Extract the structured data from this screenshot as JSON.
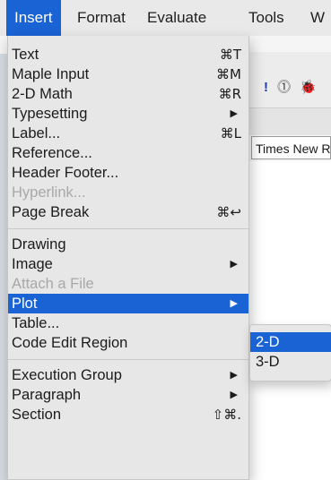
{
  "menubar": {
    "items": [
      "Insert",
      "Format",
      "Evaluate",
      "Tools",
      "W"
    ]
  },
  "background": {
    "font_box_value": "Times New Roman",
    "toolbar_icons": [
      "!",
      "⓵",
      "🐞"
    ]
  },
  "insert_menu": {
    "items": [
      {
        "label": "Text",
        "shortcut": "⌘T"
      },
      {
        "label": "Maple Input",
        "shortcut": "⌘M"
      },
      {
        "label": "2-D Math",
        "shortcut": "⌘R"
      },
      {
        "label": "Typesetting",
        "submenu": true
      },
      {
        "label": "Label...",
        "shortcut": "⌘L"
      },
      {
        "label": "Reference..."
      },
      {
        "label": "Header Footer..."
      },
      {
        "label": "Hyperlink...",
        "disabled": true
      },
      {
        "label": "Page Break",
        "shortcut": "⌘↩"
      },
      {
        "label": "Drawing"
      },
      {
        "label": "Image",
        "submenu": true
      },
      {
        "label": "Attach a File",
        "disabled": true
      },
      {
        "label": "Plot",
        "submenu": true,
        "highlighted": true
      },
      {
        "label": "Table..."
      },
      {
        "label": "Code Edit Region"
      },
      {
        "label": "Execution Group",
        "submenu": true
      },
      {
        "label": "Paragraph",
        "submenu": true
      },
      {
        "label": "Section",
        "shortcut": "⇧⌘."
      }
    ]
  },
  "plot_submenu": {
    "items": [
      {
        "label": "2-D",
        "highlighted": true
      },
      {
        "label": "3-D"
      }
    ]
  },
  "colors": {
    "highlight": "#1a63d4",
    "menu_bg": "#e7e7e7",
    "disabled_text": "#a8a8a8"
  }
}
